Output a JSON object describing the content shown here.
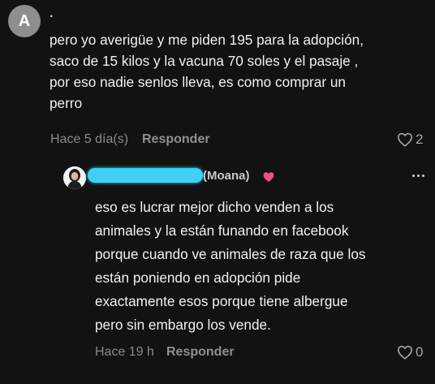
{
  "comment": {
    "avatar_letter": "A",
    "username": ".",
    "text": "pero yo averigüe y me piden 195 para la adopción,\nsaco de 15 kilos y la vacuna 70 soles y el pasaje ,\npor eso nadie senlos lleva, es como comprar un\nperro",
    "timestamp": "Hace 5 día(s)",
    "reply_label": "Responder",
    "like_count": "2"
  },
  "reply": {
    "username_suffix": "(Moana)",
    "text": "eso es lucrar mejor dicho venden a los\nanimales y la están funando en facebook\nporque cuando ve animales de raza que los\nestán poniendo en adopción pide\nexactamente esos porque tiene albergue\npero sin embargo los vende.",
    "timestamp": "Hace 19 h",
    "reply_label": "Responder",
    "like_count": "0"
  },
  "colors": {
    "background": "#121212",
    "redaction": "#3fd0f6",
    "heart_emoji": "#f0508a"
  },
  "icons": {
    "like": "heart-outline-icon",
    "more": "more-horizontal-icon",
    "emoji": "pink-heart-emoji"
  }
}
